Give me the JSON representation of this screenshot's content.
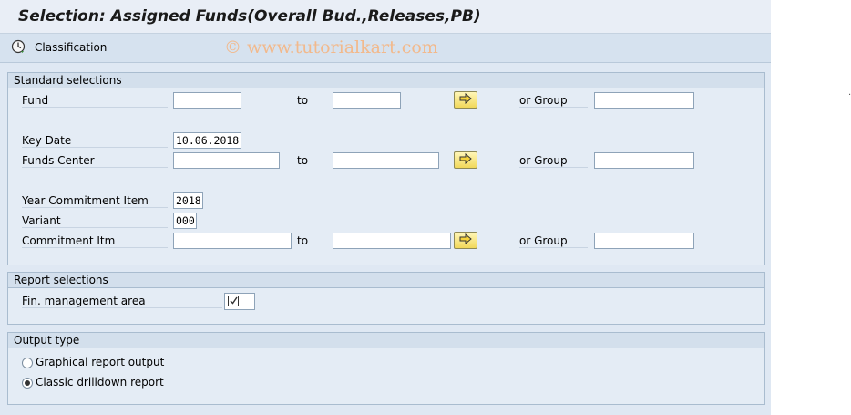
{
  "window": {
    "title": "Selection: Assigned Funds(Overall Bud.,Releases,PB)"
  },
  "toolbar": {
    "classification_label": "Classification"
  },
  "watermark": "© www.tutorialkart.com",
  "standard": {
    "header": "Standard selections",
    "fund_label": "Fund",
    "to_label": "to",
    "or_group_label": "or Group",
    "key_date_label": "Key Date",
    "key_date_value": "10.06.2018",
    "funds_center_label": "Funds Center",
    "year_ci_label": "Year Commitment Item",
    "year_ci_value": "2018",
    "variant_label": "Variant",
    "variant_value": "000",
    "commitment_itm_label": "Commitment Itm"
  },
  "report": {
    "header": "Report selections",
    "fm_area_label": "Fin. management area"
  },
  "output": {
    "header": "Output type",
    "graphical_label": "Graphical report output",
    "classic_label": "Classic drilldown report",
    "selected": "classic"
  },
  "colors": {
    "title_bg": "#e9eef6",
    "screen_bg": "#dfe8f3",
    "button_yellow": "#f1d85a"
  },
  "icons": [
    "clock-icon",
    "arrow-right-icon",
    "checkbox-icon"
  ],
  "edge_mark": "."
}
